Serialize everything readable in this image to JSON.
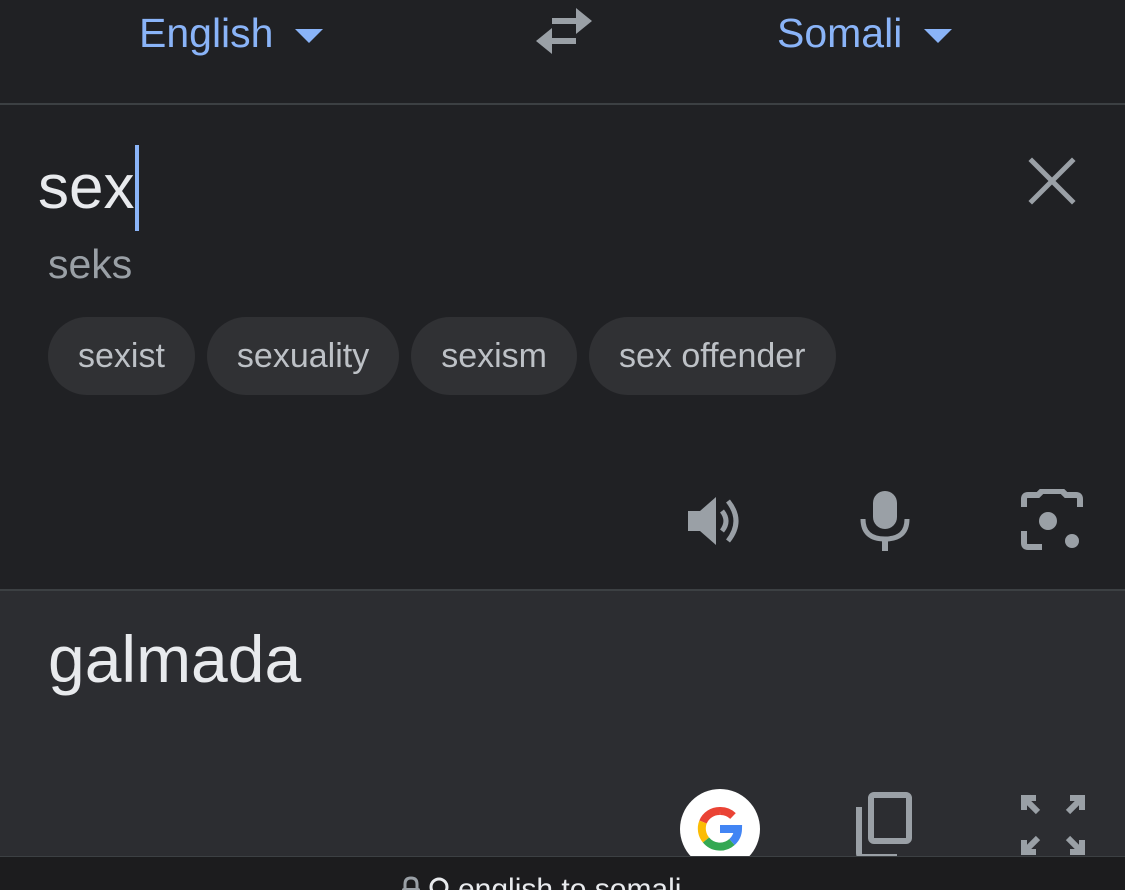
{
  "languages": {
    "source": "English",
    "target": "Somali"
  },
  "input": {
    "text": "sex",
    "transliteration": "seks",
    "suggestions": [
      "sexist",
      "sexuality",
      "sexism",
      "sex offender"
    ]
  },
  "output": {
    "text": "galmada"
  },
  "browser": {
    "address": "english to somali"
  },
  "colors": {
    "accent": "#8ab4f8",
    "background": "#202124",
    "output_background": "#2c2d31",
    "chip_background": "#303134"
  },
  "icons": [
    "swap-icon",
    "clear-icon",
    "speaker-icon",
    "mic-icon",
    "camera-icon",
    "google-icon",
    "copy-icon",
    "fullscreen-icon",
    "lock-icon",
    "search-icon"
  ]
}
